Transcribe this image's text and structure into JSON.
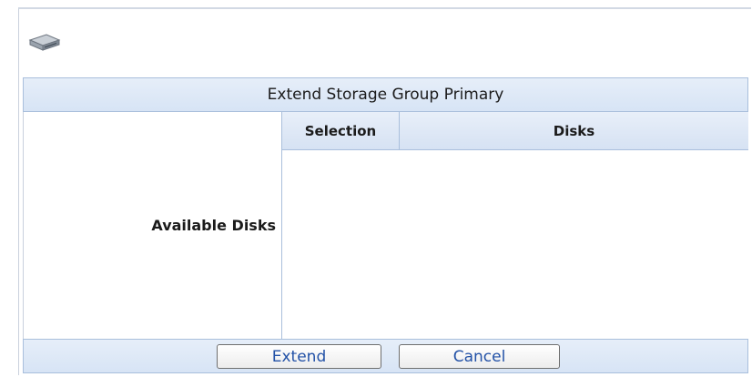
{
  "dialog": {
    "title": "Extend Storage Group Primary",
    "icon": "disk-drive-icon"
  },
  "form": {
    "available_disks_label": "Available Disks"
  },
  "table": {
    "columns": [
      "Selection",
      "Disks"
    ],
    "rows": []
  },
  "buttons": {
    "extend_label": "Extend",
    "cancel_label": "Cancel"
  },
  "colors": {
    "header_background": "#dbe6f6",
    "border": "#a9bfdc",
    "button_text": "#2352a7"
  }
}
